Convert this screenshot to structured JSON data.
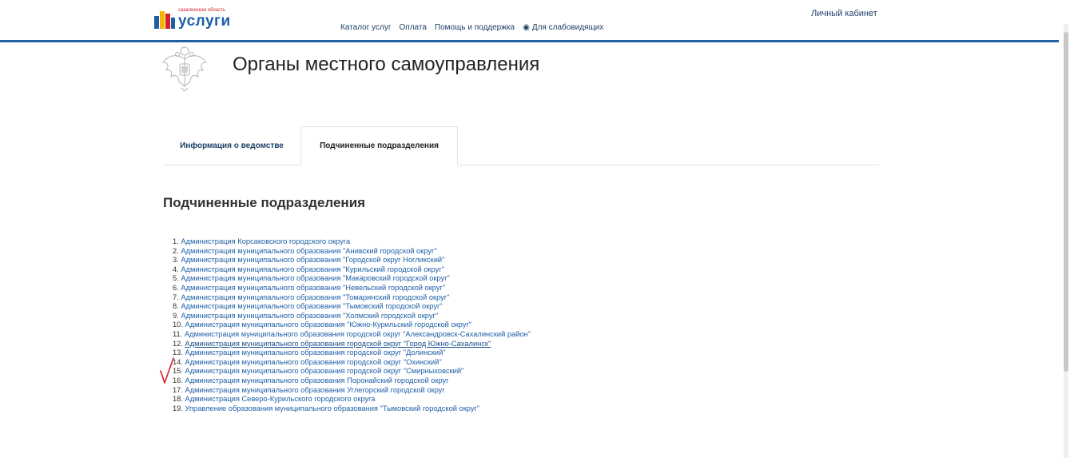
{
  "header": {
    "logo_small": "сахалинская область",
    "logo_big": "услуги",
    "nav": [
      {
        "label": "Каталог услуг"
      },
      {
        "label": "Оплата"
      },
      {
        "label": "Помощь и поддержка"
      },
      {
        "label": "Для слабовидящих",
        "icon": "eye-icon"
      }
    ],
    "cabinet": "Личный кабинет"
  },
  "page": {
    "title": "Органы местного самоуправления"
  },
  "tabs": [
    {
      "label": "Информация о ведомстве",
      "active": false
    },
    {
      "label": "Подчиненные подразделения",
      "active": true
    }
  ],
  "section": {
    "title": "Подчиненные подразделения",
    "items": [
      {
        "num": "1.",
        "label": "Администрация Корсаковского городского округа"
      },
      {
        "num": "2.",
        "label": "Администрация муниципального образования \"Анивский городской округ\""
      },
      {
        "num": "3.",
        "label": "Администрация муниципального образования \"Городской округ Ногликский\""
      },
      {
        "num": "4.",
        "label": "Администрация муниципального образования \"Курильский городской округ\""
      },
      {
        "num": "5.",
        "label": "Администрация муниципального образования \"Макаровский городской округ\""
      },
      {
        "num": "6.",
        "label": "Администрация муниципального образования \"Невельский городской округ\""
      },
      {
        "num": "7.",
        "label": "Администрация муниципального образования \"Томаринский городской округ\""
      },
      {
        "num": "8.",
        "label": "Администрация муниципального образования \"Тымовский городской округ\""
      },
      {
        "num": "9.",
        "label": "Администрация муниципального образования \"Холмский городской округ\""
      },
      {
        "num": "10.",
        "label": "Администрация муниципального образования \"Южно-Курильский городской округ\""
      },
      {
        "num": "11.",
        "label": "Администрация муниципального образования городской округ \"Александровск-Сахалинский район\""
      },
      {
        "num": "12.",
        "label": "Администрация муниципального образования городской округ \"Город Южно-Сахалинск\"",
        "selected": true
      },
      {
        "num": "13.",
        "label": "Администрация муниципального образования городской округ \"Долинский\""
      },
      {
        "num": "14.",
        "label": "Администрация муниципального образования городской округ \"Охинский\""
      },
      {
        "num": "15.",
        "label": "Администрация муниципального образования городской округ \"Смирныховский\""
      },
      {
        "num": "16.",
        "label": "Администрация муниципального образования Поронайский городской округ"
      },
      {
        "num": "17.",
        "label": "Администрация муниципального образования Углегорский городской округ"
      },
      {
        "num": "18.",
        "label": "Администрация Северо-Курильского городского округа"
      },
      {
        "num": "19.",
        "label": "Управление образования муниципального образования \"Тымовский городской округ\""
      }
    ]
  },
  "colors": {
    "brand_blue": "#1e5fa8",
    "link": "#1e5fa8",
    "check_mark": "#d61f26"
  }
}
